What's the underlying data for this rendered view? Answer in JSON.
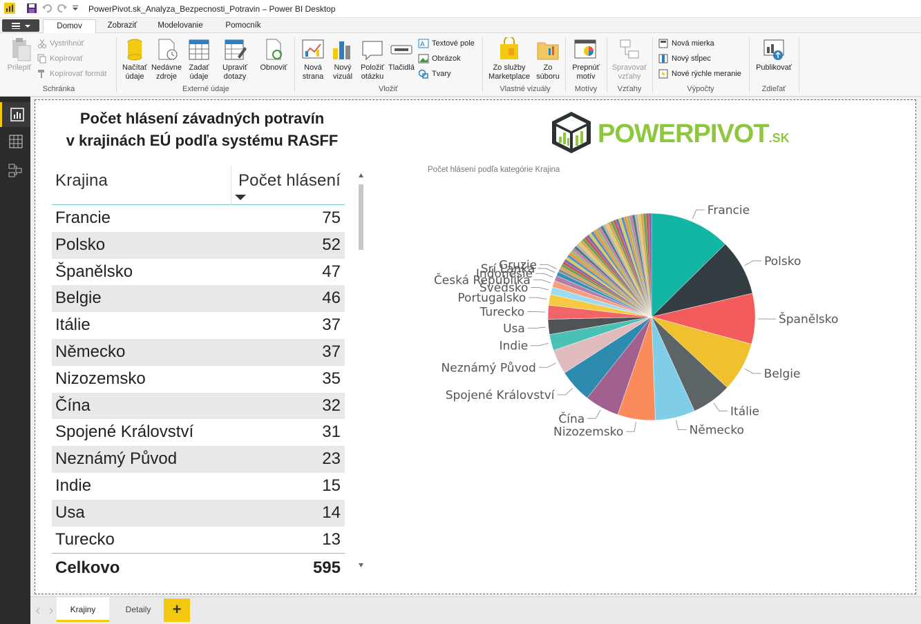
{
  "window": {
    "title": "PowerPivot.sk_Analyza_Bezpecnosti_Potravin – Power BI Desktop"
  },
  "ribbon": {
    "tabs": [
      "Domov",
      "Zobraziť",
      "Modelovanie",
      "Pomocník"
    ],
    "paste": "Prilepiť",
    "cut": "Vystrihnúť",
    "copy": "Kopírovať",
    "copy_format": "Kopírovať formát",
    "get_data": "Načítať údaje",
    "recent_sources": "Nedávne zdroje",
    "enter_data": "Zadať údaje",
    "edit_queries": "Upraviť dotazy",
    "refresh": "Obnoviť",
    "new_page": "Nová strana",
    "new_visual": "Nový vizuál",
    "ask_question": "Položiť otázku",
    "buttons": "Tlačidlá",
    "textbox": "Textové pole",
    "image": "Obrázok",
    "shapes": "Tvary",
    "from_marketplace": "Zo služby Marketplace",
    "from_file": "Zo súboru",
    "switch_theme": "Prepnúť motív",
    "manage_relationships": "Spravovať vzťahy",
    "new_measure": "Nová mierka",
    "new_column": "Nový stĺpec",
    "new_quick_measure": "Nové rýchle meranie",
    "publish": "Publikovať",
    "groups": [
      "Schránka",
      "Externé údaje",
      "Vložiť",
      "Vlastné vizuály",
      "Motívy",
      "Vzťahy",
      "Výpočty",
      "Zdieľať"
    ]
  },
  "report": {
    "title_line1": "Počet hlásení závadných potravín",
    "title_line2": "v krajinách EÚ podľa systému RASFF",
    "logo_text_a": "POWERPIVOT",
    "logo_text_b": ".SK"
  },
  "table": {
    "headers": [
      "Krajina",
      "Počet hlásení"
    ],
    "rows": [
      [
        "Francie",
        "75"
      ],
      [
        "Polsko",
        "52"
      ],
      [
        "Španělsko",
        "47"
      ],
      [
        "Belgie",
        "46"
      ],
      [
        "Itálie",
        "37"
      ],
      [
        "Německo",
        "37"
      ],
      [
        "Nizozemsko",
        "35"
      ],
      [
        "Čína",
        "32"
      ],
      [
        "Spojené Království",
        "31"
      ],
      [
        "Neznámý Původ",
        "23"
      ],
      [
        "Indie",
        "15"
      ],
      [
        "Usa",
        "14"
      ],
      [
        "Turecko",
        "13"
      ]
    ],
    "total_label": "Celkovo",
    "total_value": "595"
  },
  "chart_data": {
    "type": "pie",
    "title": "Počet hlásení podľa kategórie Krajina",
    "total": 595,
    "slices": [
      {
        "label": "Francie",
        "value": 75,
        "color": "#13B5A4"
      },
      {
        "label": "Polsko",
        "value": 52,
        "color": "#333D42"
      },
      {
        "label": "Španělsko",
        "value": 47,
        "color": "#F35B5C"
      },
      {
        "label": "Belgie",
        "value": 46,
        "color": "#F0C12F"
      },
      {
        "label": "Itálie",
        "value": 37,
        "color": "#5C6466"
      },
      {
        "label": "Německo",
        "value": 37,
        "color": "#80CDE7"
      },
      {
        "label": "Nizozemsko",
        "value": 35,
        "color": "#FC8B5C"
      },
      {
        "label": "Čína",
        "value": 32,
        "color": "#A2608F"
      },
      {
        "label": "Spojené Království",
        "value": 31,
        "color": "#2D8BB0"
      },
      {
        "label": "Neznámý Původ",
        "value": 23,
        "color": "#E0BBBD"
      },
      {
        "label": "Indie",
        "value": 15,
        "color": "#4AC1B5"
      },
      {
        "label": "Usa",
        "value": 14,
        "color": "#4F5356"
      },
      {
        "label": "Turecko",
        "value": 13,
        "color": "#F26566"
      },
      {
        "label": "Portugalsko",
        "value": 10,
        "color": "#F6C942"
      },
      {
        "label": "Švédsko",
        "value": 7,
        "color": "#9CDCF0"
      },
      {
        "label": "Česká Republika",
        "value": 6,
        "color": "#F69E7E"
      },
      {
        "label": "Indonésie",
        "value": 5,
        "color": "#B37FA8"
      },
      {
        "label": "Srí Lanka",
        "value": 4,
        "color": "#3A90B4"
      },
      {
        "label": "Gruzie",
        "value": 3,
        "color": "#8A8F91"
      }
    ],
    "other_colors": [
      "#D8A65D",
      "#6B9F54",
      "#C15B5B",
      "#7E6AAE",
      "#D1D15A",
      "#5B8FC7",
      "#E79B3A",
      "#9DB96A",
      "#C77DB3",
      "#4E7C7A",
      "#B5B5B5",
      "#E1C96A"
    ]
  },
  "page_tabs": [
    "Krajiny",
    "Detaily"
  ],
  "add_page": "+"
}
